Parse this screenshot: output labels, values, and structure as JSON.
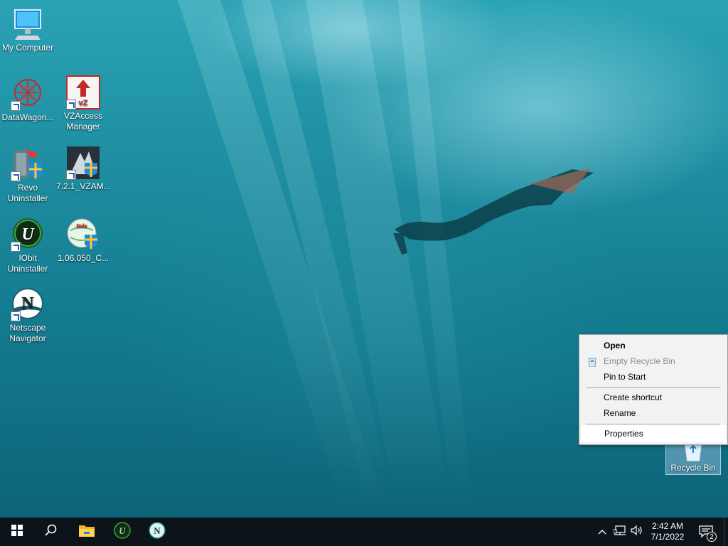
{
  "desktop": {
    "icons": [
      {
        "label": "My Computer",
        "icon": "computer-icon"
      },
      {
        "label": "DataWagon...",
        "icon": "datawagon-icon"
      },
      {
        "label": "VZAccess Manager",
        "icon": "vzaccess-icon"
      },
      {
        "label": "Revo Uninstaller",
        "icon": "revo-uninstaller-icon"
      },
      {
        "label": "7.2.1_VZAM...",
        "icon": "vzam-installer-icon"
      },
      {
        "label": "IObit Uninstaller",
        "icon": "iobit-uninstaller-icon"
      },
      {
        "label": "1.06.050_C...",
        "icon": "installer-globe-icon"
      },
      {
        "label": "Netscape Navigator",
        "icon": "netscape-icon"
      },
      {
        "label": "Recycle Bin",
        "icon": "recycle-bin-icon"
      }
    ]
  },
  "context_menu": {
    "items": [
      {
        "label": "Open",
        "bold": true
      },
      {
        "label": "Empty Recycle Bin",
        "disabled": true,
        "icon": "empty-recycle-bin-icon"
      },
      {
        "label": "Pin to Start"
      },
      {
        "label": "Create shortcut"
      },
      {
        "label": "Rename"
      },
      {
        "label": "Properties",
        "highlighted": true
      }
    ]
  },
  "taskbar": {
    "start": "windows-start-icon",
    "search": "search-icon",
    "pinned": [
      "file-explorer-icon",
      "iobit-uninstaller-icon",
      "netscape-icon"
    ],
    "tray": {
      "chevron": "chevron-up-icon",
      "network": "network-icon",
      "volume": "volume-icon",
      "time": "2:42 AM",
      "date": "7/1/2022",
      "notification_count": "2"
    }
  }
}
